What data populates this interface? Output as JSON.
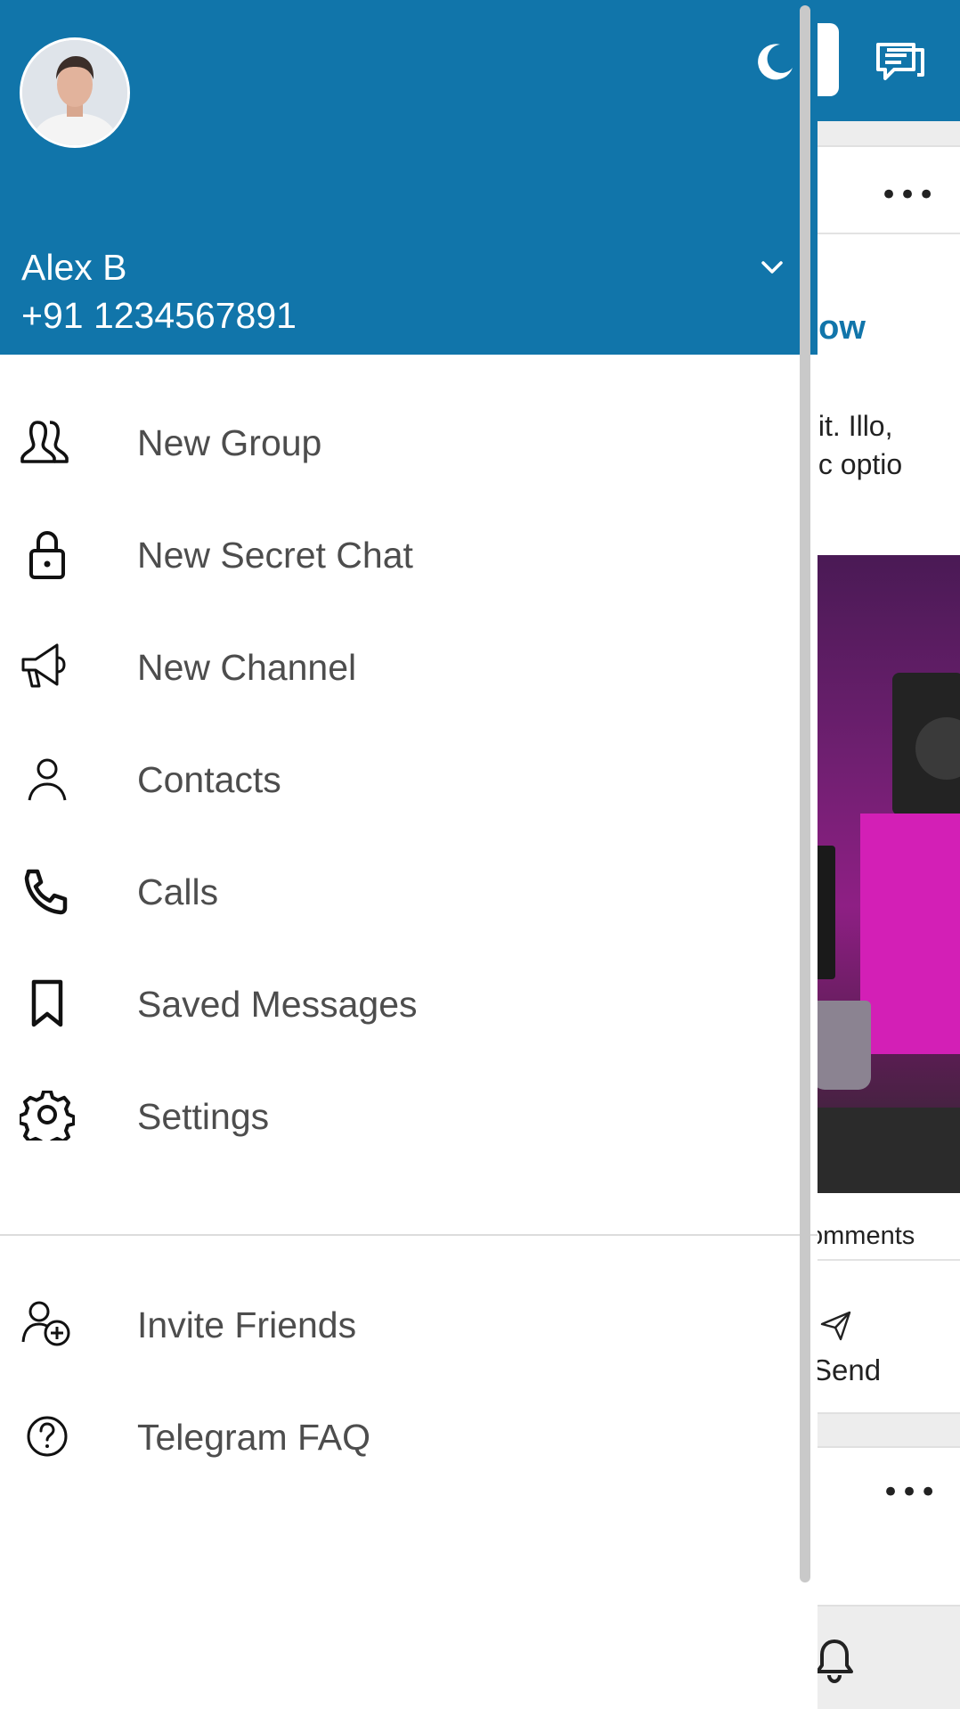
{
  "background": {
    "card_fragment_title": "llow",
    "card_fragment_text_1": "elit.  Illo,",
    "card_fragment_text_2": "hic optio",
    "comments_fragment": "omments",
    "send_fragment": "Send",
    "more_label": "•••"
  },
  "drawer": {
    "user": {
      "name": "Alex B",
      "phone": "+91 1234567891"
    },
    "menu": [
      {
        "label": "New Group",
        "icon": "group-icon"
      },
      {
        "label": "New Secret Chat",
        "icon": "lock-icon"
      },
      {
        "label": "New Channel",
        "icon": "megaphone-icon"
      },
      {
        "label": "Contacts",
        "icon": "person-icon"
      },
      {
        "label": "Calls",
        "icon": "phone-icon"
      },
      {
        "label": "Saved Messages",
        "icon": "bookmark-icon"
      },
      {
        "label": "Settings",
        "icon": "gear-icon"
      }
    ],
    "secondary_menu": [
      {
        "label": "Invite Friends",
        "icon": "add-user-icon"
      },
      {
        "label": "Telegram FAQ",
        "icon": "help-icon"
      }
    ]
  },
  "colors": {
    "header": "#1175aa",
    "menu_text": "#4d4d4d",
    "accent_pink": "#d31fb6"
  }
}
